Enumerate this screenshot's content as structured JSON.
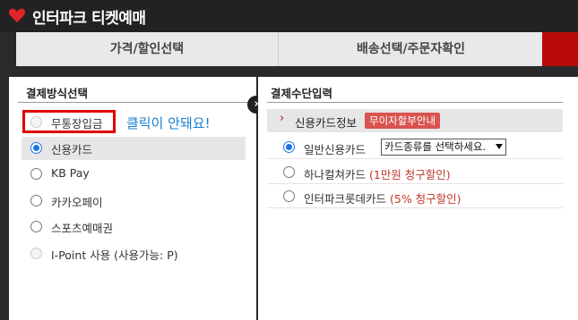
{
  "header": {
    "brand": "인터파크 티켓예매",
    "logo_icon": "heart-logo-icon"
  },
  "steps": [
    {
      "label": "가격/할인선택"
    },
    {
      "label": "배송선택/주문자확인"
    }
  ],
  "colors": {
    "accent_red": "#b90a0a",
    "highlight": "#e00000",
    "radio_blue": "#1a73e8",
    "note_blue": "#1a7fd1",
    "promo_red": "#c0392b",
    "badge_bg": "#d9534f"
  },
  "payment_method": {
    "title": "결제방식선택",
    "options": [
      {
        "label": "무통장입금",
        "state": "disabled"
      },
      {
        "label": "신용카드",
        "state": "selected"
      },
      {
        "label": "KB Pay",
        "state": "normal"
      },
      {
        "label": "카카오페이",
        "state": "normal"
      },
      {
        "label": "스포츠예매권",
        "state": "normal"
      },
      {
        "label": "I-Point 사용 (사용가능: P)",
        "state": "disabled"
      }
    ],
    "annotation": "클릭이 안돼요!"
  },
  "payment_input": {
    "title": "결제수단입력",
    "card_info_label": "신용카드정보",
    "installment_badge": "무이자할부안내",
    "options": [
      {
        "label": "일반신용카드",
        "promo": "",
        "selected": true
      },
      {
        "label": "하나컬쳐카드",
        "promo": "(1만원 청구할인)",
        "selected": false
      },
      {
        "label": "인터파크롯데카드",
        "promo": "(5% 청구할인)",
        "selected": false
      }
    ],
    "card_select": {
      "value": "카드종류를 선택하세요."
    }
  },
  "arrow_icon": "chevron-right-icon"
}
